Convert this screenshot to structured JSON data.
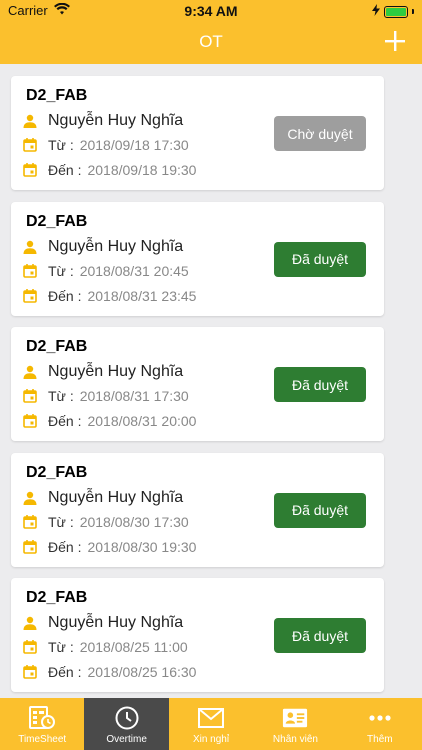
{
  "status_bar": {
    "carrier": "Carrier",
    "time": "9:34 AM"
  },
  "header": {
    "title": "OT",
    "add_icon": "plus-icon"
  },
  "colors": {
    "brand": "#fbc02d",
    "approved": "#2e7d32",
    "pending": "#9e9e9e",
    "active_tab": "#4a4a4a",
    "icon": "#f5b800"
  },
  "requests": [
    {
      "code": "D2_FAB",
      "name": "Nguyễn Huy Nghĩa",
      "from_label": "Từ :",
      "from": "2018/09/18 17:30",
      "to_label": "Đến :",
      "to": "2018/09/18 19:30",
      "status": "Chờ duyệt",
      "status_type": "pending"
    },
    {
      "code": "D2_FAB",
      "name": "Nguyễn Huy Nghĩa",
      "from_label": "Từ :",
      "from": "2018/08/31 20:45",
      "to_label": "Đến :",
      "to": "2018/08/31 23:45",
      "status": "Đã duyệt",
      "status_type": "approved"
    },
    {
      "code": "D2_FAB",
      "name": "Nguyễn Huy Nghĩa",
      "from_label": "Từ :",
      "from": "2018/08/31 17:30",
      "to_label": "Đến :",
      "to": "2018/08/31 20:00",
      "status": "Đã duyệt",
      "status_type": "approved"
    },
    {
      "code": "D2_FAB",
      "name": "Nguyễn Huy Nghĩa",
      "from_label": "Từ :",
      "from": "2018/08/30 17:30",
      "to_label": "Đến :",
      "to": "2018/08/30 19:30",
      "status": "Đã duyệt",
      "status_type": "approved"
    },
    {
      "code": "D2_FAB",
      "name": "Nguyễn Huy Nghĩa",
      "from_label": "Từ :",
      "from": "2018/08/25 11:00",
      "to_label": "Đến :",
      "to": "2018/08/25 16:30",
      "status": "Đã duyệt",
      "status_type": "approved"
    }
  ],
  "tabs": [
    {
      "label": "TimeSheet",
      "icon": "timesheet-icon",
      "active": false
    },
    {
      "label": "Overtime",
      "icon": "clock-icon",
      "active": true
    },
    {
      "label": "Xin nghỉ",
      "icon": "mail-icon",
      "active": false
    },
    {
      "label": "Nhân viên",
      "icon": "id-card-icon",
      "active": false
    },
    {
      "label": "Thêm",
      "icon": "more-icon",
      "active": false
    }
  ]
}
